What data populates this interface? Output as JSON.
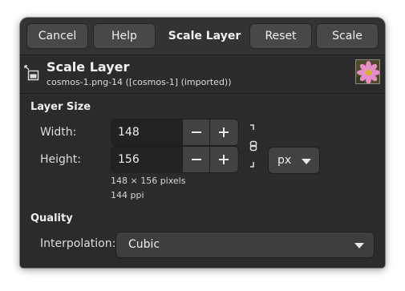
{
  "header": {
    "cancel_label": "Cancel",
    "help_label": "Help",
    "title": "Scale Layer",
    "reset_label": "Reset",
    "scale_label": "Scale"
  },
  "info": {
    "title": "Scale Layer",
    "subtitle": "cosmos-1.png-14 ([cosmos-1] (imported))",
    "icon": "scale-layer-icon",
    "thumbnail": "cosmos-flower-thumbnail"
  },
  "layer_size": {
    "section_label": "Layer Size",
    "width_label": "Width:",
    "width_value": "148",
    "height_label": "Height:",
    "height_value": "156",
    "pixels_text": "148 × 156 pixels",
    "ppi_text": "144 ppi",
    "unit": "px",
    "chain_linked": true
  },
  "quality": {
    "section_label": "Quality",
    "interpolation_label": "Interpolation:",
    "interpolation_value": "Cubic"
  },
  "colors": {
    "dialog_bg": "#2b2b2b",
    "header_bg": "#333333",
    "button_bg": "#484848",
    "entry_bg": "#222222"
  }
}
